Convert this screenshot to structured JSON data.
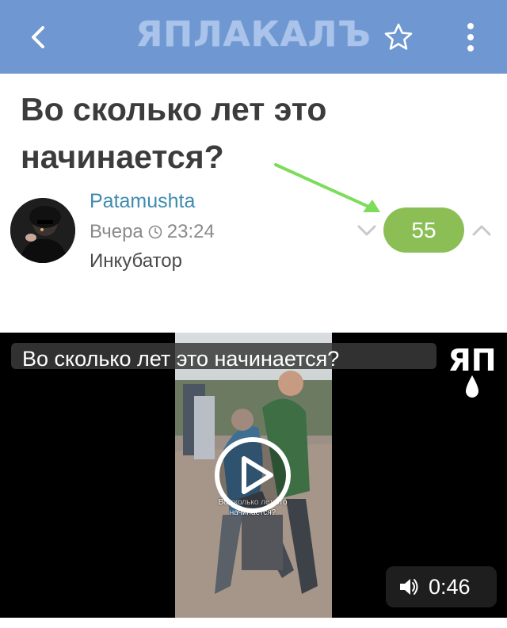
{
  "header": {
    "logo_text": "ЯПЛАКАЛЪ",
    "background_color": "#6f97d1",
    "icons": [
      "back-icon",
      "star-icon",
      "more-vertical-icon"
    ]
  },
  "post": {
    "title": "Во сколько лет это начинается?",
    "author": "Patamushta",
    "date": "Вчера",
    "time": "23:24",
    "section": "Инкубатор",
    "rating": "55",
    "rating_color": "#8bbf56"
  },
  "video": {
    "caption": "Во сколько лет это начинается?",
    "logo_text": "ЯП",
    "inner_overlay_text": "Во сколько лет это начинается?",
    "duration": "0:46"
  }
}
